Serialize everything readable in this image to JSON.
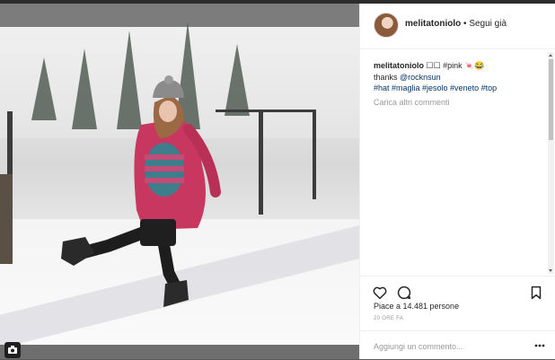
{
  "post": {
    "username": "melitatoniolo",
    "separator": "•",
    "follow_status": "Segui già"
  },
  "caption": {
    "username": "melitatoniolo",
    "text": " ☐☐ #pink 🍬😂",
    "thanks_prefix": "thanks ",
    "mention": "@rocknsun",
    "hashtags": "#hat #maglia #jesolo #veneto #top"
  },
  "load_more": "Carica altri commenti",
  "likes_text": "Piace a 14.481 persone",
  "timestamp": "20 ORE FA",
  "comment_input": {
    "placeholder": "Aggiungi un commento..."
  },
  "icons": {
    "like": "heart-outline-icon",
    "comment": "speech-bubble-icon",
    "save": "bookmark-icon",
    "more": "ellipsis-icon",
    "camera": "camera-icon"
  },
  "colors": {
    "text": "#262626",
    "muted": "#999999",
    "link": "#003569",
    "jacket": "#c8375f"
  }
}
